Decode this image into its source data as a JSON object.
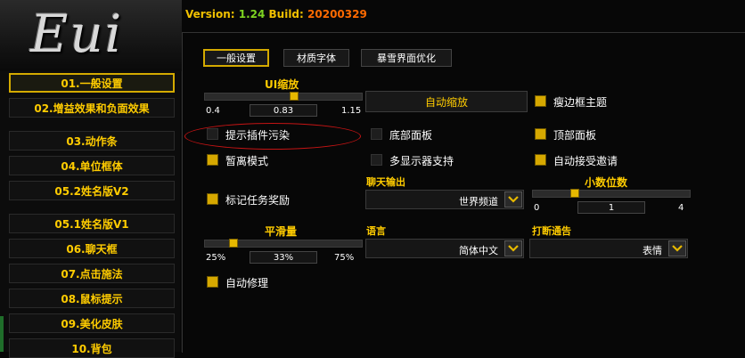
{
  "logo": "Eui",
  "version": {
    "prefix": "Version:",
    "version": "1.24",
    "build_prefix": "Build:",
    "build": "20200329"
  },
  "sidebar": {
    "items": [
      {
        "label": "01.一般设置",
        "active": true
      },
      {
        "label": "02.增益效果和负面效果"
      },
      {
        "label": "03.动作条"
      },
      {
        "label": "04.单位框体"
      },
      {
        "label": "05.2姓名版V2"
      },
      {
        "label": "05.1姓名版V1"
      },
      {
        "label": "06.聊天框"
      },
      {
        "label": "07.点击施法"
      },
      {
        "label": "08.鼠标提示"
      },
      {
        "label": "09.美化皮肤"
      },
      {
        "label": "10.背包"
      }
    ]
  },
  "tabs": [
    {
      "label": "一般设置",
      "active": true
    },
    {
      "label": "材质字体"
    },
    {
      "label": "暴雪界面优化"
    }
  ],
  "ui_scale": {
    "label": "UI缩放",
    "min": "0.4",
    "value": "0.83",
    "max": "1.15",
    "fraction": 0.57
  },
  "auto_scale_button": "自动缩放",
  "checkboxes": {
    "thin_border": {
      "label": "瘦边框主题",
      "checked": true
    },
    "plugin_taint": {
      "label": "提示插件污染",
      "checked": false
    },
    "bottom_panel": {
      "label": "底部面板",
      "checked": false
    },
    "top_panel": {
      "label": "顶部面板",
      "checked": true
    },
    "afk_mode": {
      "label": "暂离模式",
      "checked": true
    },
    "multi_monitor": {
      "label": "多显示器支持",
      "checked": false
    },
    "auto_accept": {
      "label": "自动接受邀请",
      "checked": true
    },
    "quest_reward": {
      "label": "标记任务奖励",
      "checked": true
    },
    "auto_repair": {
      "label": "自动修理",
      "checked": true
    }
  },
  "chat_output": {
    "label": "聊天输出",
    "value": "世界频道"
  },
  "decimals": {
    "label": "小数位数",
    "min": "0",
    "value": "1",
    "max": "4",
    "fraction": 0.25
  },
  "smoothing": {
    "label": "平滑量",
    "min": "25%",
    "value": "33%",
    "max": "75%",
    "fraction": 0.16
  },
  "language": {
    "label": "语言",
    "value": "简体中文"
  },
  "interrupt": {
    "label": "打断通告",
    "value": "表情"
  },
  "colors": {
    "accent": "#ffcc00",
    "checked": "#d6a800",
    "highlight": "#c41414",
    "version": "#7ed321",
    "build": "#ff6a00"
  }
}
